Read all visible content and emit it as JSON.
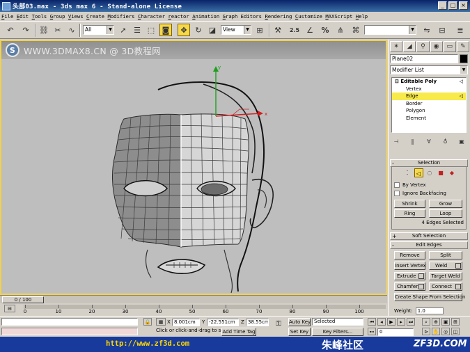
{
  "window": {
    "title": "头部03.max - 3ds max 6 - Stand-alone License",
    "buttons": [
      "_",
      "□",
      "×"
    ]
  },
  "menu": [
    "File",
    "Edit",
    "Tools",
    "Group",
    "Views",
    "Create",
    "Modifiers",
    "Character",
    "reactor",
    "Animation",
    "Graph Editors",
    "Rendering",
    "Customize",
    "MAXScript",
    "Help"
  ],
  "toolbar": {
    "selection_filter": "All",
    "reference_coord": "View",
    "snap_value": "2.5",
    "percent_snap": "%",
    "named_selection": ""
  },
  "viewport": {
    "watermark": "WWW.3DMAX8.CN @ 3D教程网",
    "logo_letter": "S",
    "border_color": "#f2d24a"
  },
  "command_panel": {
    "object_name": "Plane02",
    "modifier_list": "Modifier List",
    "stack": {
      "root": "Editable Poly",
      "subs": [
        "Vertex",
        "Edge",
        "Border",
        "Polygon",
        "Element"
      ],
      "selected": "Edge"
    },
    "selection_rollout": {
      "title": "Selection",
      "by_vertex": "By Vertex",
      "ignore_backfacing": "Ignore Backfacing",
      "shrink": "Shrink",
      "grow": "Grow",
      "ring": "Ring",
      "loop": "Loop",
      "status": "4 Edges Selected"
    },
    "soft_selection_title": "Soft Selection",
    "edit_edges": {
      "title": "Edit Edges",
      "remove": "Remove",
      "split": "Split",
      "insert_vertex": "Insert Vertex",
      "weld": "Weld",
      "extrude": "Extrude",
      "target_weld": "Target Weld",
      "chamfer": "Chamfer",
      "connect": "Connect",
      "create_shape": "Create Shape From Selection",
      "weight_label": "Weight:",
      "weight_value": "1.0"
    }
  },
  "time": {
    "slider": "0 / 100",
    "ticks": [
      "0",
      "10",
      "20",
      "30",
      "40",
      "50",
      "60",
      "70",
      "80",
      "90",
      "100"
    ]
  },
  "status": {
    "prompt": "Click or click-and-drag to select ob",
    "add_time_tag": "Add Time Tag",
    "x_label": "X",
    "x_value": "8.001cm",
    "y_label": "Y",
    "y_value": "-22.551cm",
    "z_label": "Z",
    "z_value": "38.55cm",
    "auto_key": "Auto Key",
    "set_key": "Set Key",
    "key_filter_select": "Selected",
    "key_filters": "Key Filters...",
    "frame": "0"
  },
  "footer": {
    "url": "http://www.zf3d.com",
    "site_cn": "朱峰社区",
    "brand": "ZF3D.COM"
  },
  "colors": {
    "title_bar": "#0a246a",
    "highlight": "#f7ea4a",
    "footer": "#173a9c",
    "footer_url": "#ffd800"
  }
}
